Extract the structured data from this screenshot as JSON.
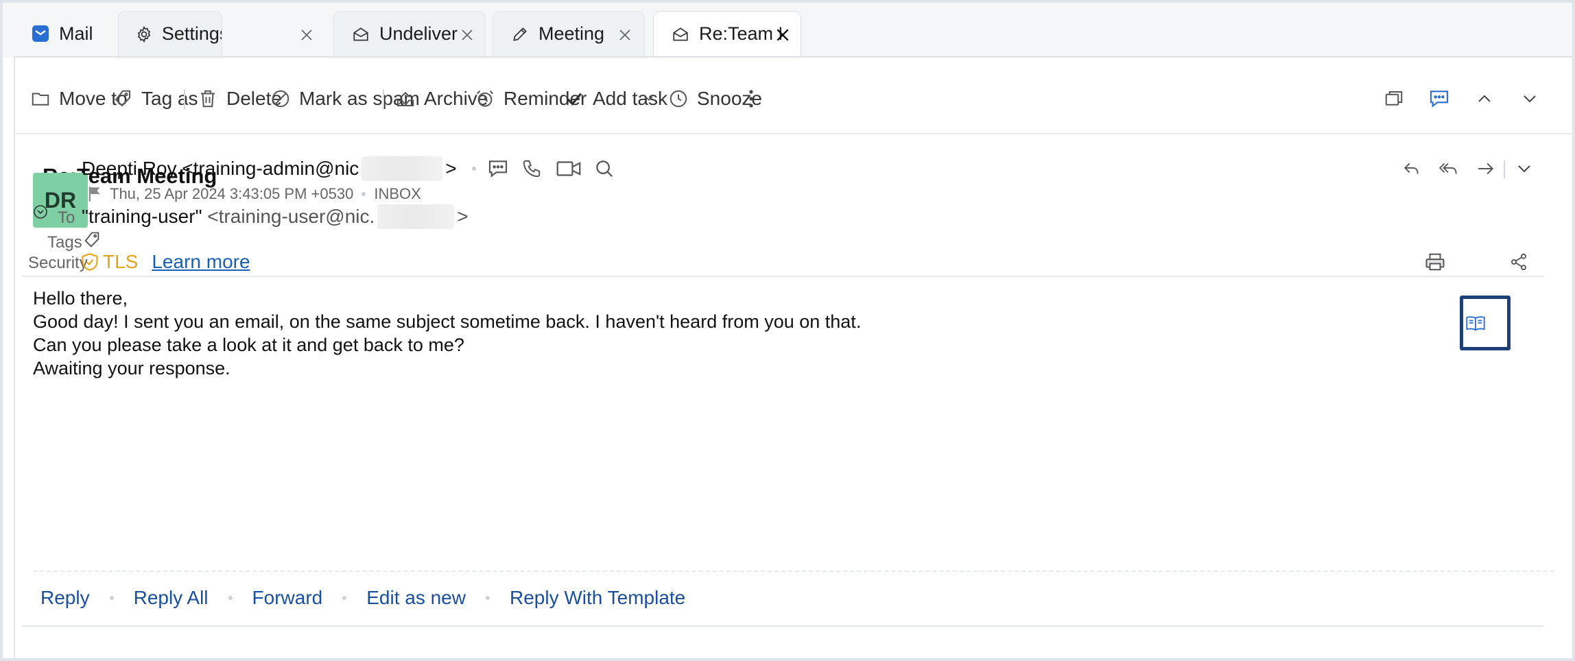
{
  "tabs": [
    {
      "label": "Mail",
      "icon": "mail-app-icon"
    },
    {
      "label": "Settings",
      "icon": "gear-icon"
    },
    {
      "label": "Undelivered",
      "icon": "envelope-open-icon"
    },
    {
      "label": "Meeting",
      "icon": "pencil-icon"
    },
    {
      "label": "Re:Team Meeting",
      "icon": "envelope-open-icon"
    }
  ],
  "toolbar": {
    "move_to": "Move to",
    "tag_as": "Tag as",
    "delete": "Delete",
    "mark_as_spam": "Mark as spam",
    "archive": "Archive",
    "reminder": "Reminder",
    "add_task": "Add task",
    "snooze": "Snooze"
  },
  "email": {
    "subject": "Re:Team Meeting",
    "avatar_initials": "DR",
    "avatar_color": "#7fcfa4",
    "sender_name": "Deepti Roy",
    "sender_email_prefix": "<training-admin@nic",
    "sender_email_suffix": ">",
    "date": "Thu, 25 Apr 2024 3:43:05 PM +0530",
    "folder": "INBOX",
    "to_label": "To",
    "to_name": "\"training-user\"",
    "to_email_prefix": "<training-user@nic.",
    "to_email_suffix": ">",
    "tags_label": "Tags",
    "security_label": "Security",
    "tls_label": "TLS",
    "learn_more": "Learn more",
    "body_lines": [
      "Hello there,",
      "Good day! I sent you an email, on the same subject sometime back. I haven't heard from you on that.",
      "Can you please take a look at it and get back to me?",
      "Awaiting your response."
    ]
  },
  "footer_actions": [
    "Reply",
    "Reply All",
    "Forward",
    "Edit as new",
    "Reply With Template"
  ],
  "colors": {
    "accent": "#1a4fa0",
    "tls": "#e8a317",
    "highlight": "#1e3f78"
  }
}
